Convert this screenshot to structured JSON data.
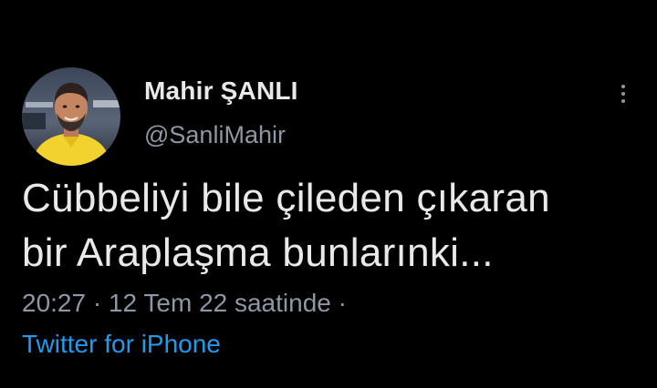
{
  "author": {
    "display_name": "Mahir ŞANLI",
    "handle": "@SanliMahir",
    "avatar_icon": "user-photo-avatar"
  },
  "menu": {
    "icon": "more-vertical-icon"
  },
  "tweet": {
    "text_lines": [
      "Cübbeliyi bile çileden çıkaran",
      "bir Araplaşma bunlarınki..."
    ]
  },
  "meta": {
    "time": "20:27",
    "separator": " · ",
    "date": "12 Tem 22 saatinde",
    "trailing_separator": " ·"
  },
  "source": {
    "label": "Twitter for iPhone"
  },
  "colors": {
    "background": "#000000",
    "primary_text": "#e7e9ea",
    "secondary_text": "#8b98a5",
    "link": "#1d9bf0",
    "avatar_shirt": "#f2d22e"
  }
}
